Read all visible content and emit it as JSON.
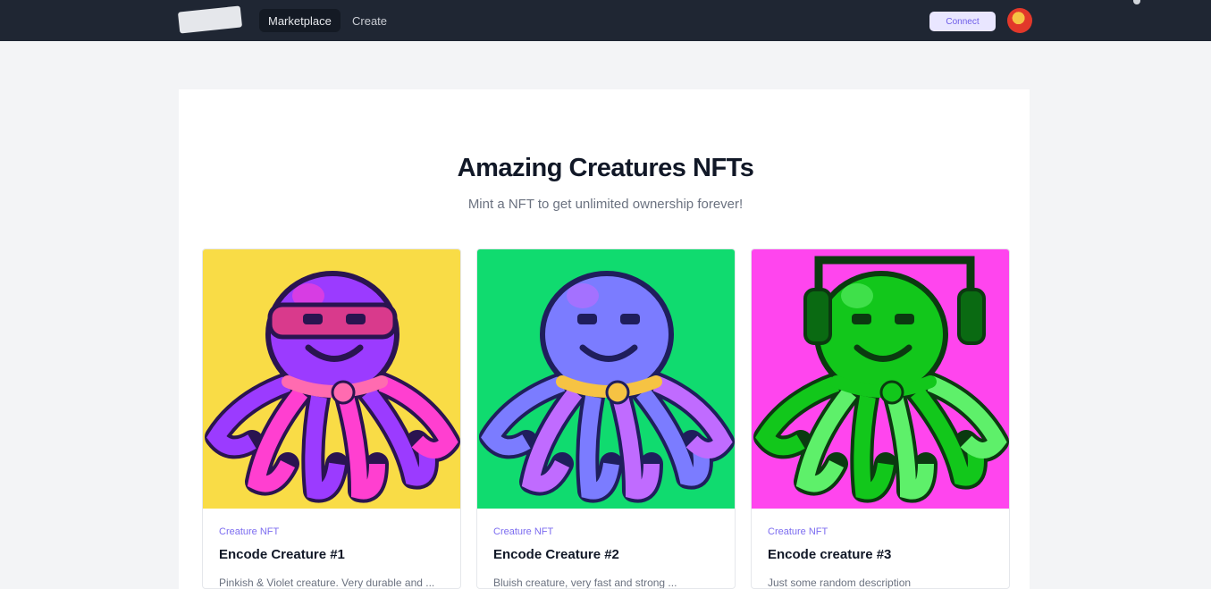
{
  "nav": {
    "logo_text": "",
    "links": [
      {
        "label": "Marketplace",
        "active": true
      },
      {
        "label": "Create",
        "active": false
      }
    ],
    "connect_label": "Connect"
  },
  "hero": {
    "title": "Amazing Creatures NFTs",
    "subtitle": "Mint a NFT to get unlimited ownership forever!"
  },
  "cards": [
    {
      "category": "Creature NFT",
      "title": "Encode Creature #1",
      "description": "Pinkish & Violet creature. Very durable and ...",
      "background_color": "#f9dc46",
      "body_color": "#9b3bff",
      "accent_color": "#ff3fd0",
      "band_color": "#d93a8c",
      "collar_color": "#ff6bb0",
      "outline_color": "#2a1450",
      "has_headphones": false
    },
    {
      "category": "Creature NFT",
      "title": "Encode Creature #2",
      "description": "Bluish creature, very fast and strong ...",
      "background_color": "#10db6f",
      "body_color": "#7b7cff",
      "accent_color": "#c06bff",
      "band_color": "#7b7cff",
      "collar_color": "#f6c343",
      "outline_color": "#1f1e5c",
      "has_headphones": false
    },
    {
      "category": "Creature NFT",
      "title": "Encode creature #3",
      "description": "Just some random description",
      "background_color": "#ff45ee",
      "body_color": "#12c71b",
      "accent_color": "#5ef06a",
      "band_color": "#12c71b",
      "collar_color": "#12c71b",
      "outline_color": "#0b3a10",
      "has_headphones": true
    }
  ]
}
